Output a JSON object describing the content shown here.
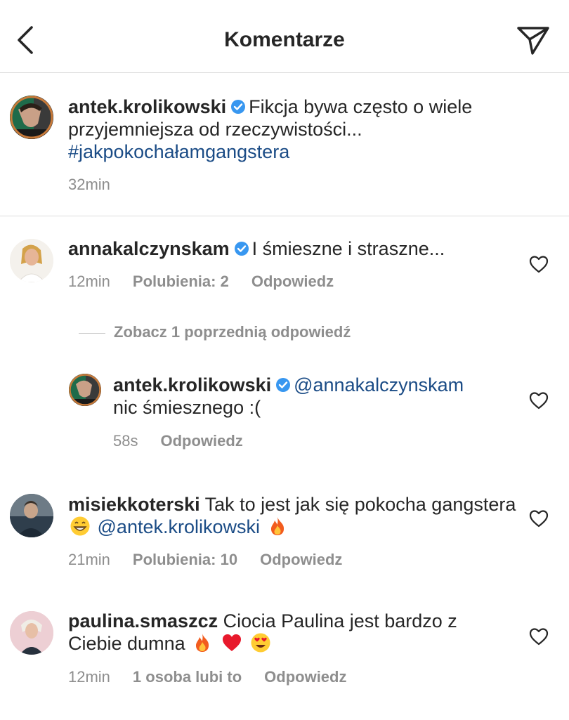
{
  "header": {
    "title": "Komentarze",
    "back_icon": "chevron-left-icon",
    "send_icon": "paper-plane-icon"
  },
  "caption": {
    "username": "antek.krolikowski",
    "text": "Fikcja bywa często o wiele przyjemniejsza od rzeczywistości...",
    "hashtag": "#jakpokochałamgangstera",
    "time": "32min"
  },
  "comments": [
    {
      "username": "annakalczynskam",
      "text": "I śmieszne i straszne...",
      "time": "12min",
      "likes": "Polubienia: 2",
      "reply": "Odpowiedz",
      "view_replies": "Zobacz 1 poprzednią odpowiedź",
      "replies": [
        {
          "username": "antek.krolikowski",
          "mention": "@annakalczynskam",
          "text": "nic śmiesznego :(",
          "time": "58s",
          "reply": "Odpowiedz"
        }
      ]
    },
    {
      "username": "misiekkoterski",
      "text_before": "Tak to jest jak się pokocha gangstera",
      "mention": "@antek.krolikowski",
      "time": "21min",
      "likes": "Polubienia: 10",
      "reply": "Odpowiedz"
    },
    {
      "username": "paulina.smaszcz",
      "text": "Ciocia Paulina jest bardzo z Ciebie dumna",
      "time": "12min",
      "likes": "1 osoba lubi to",
      "reply": "Odpowiedz"
    }
  ],
  "colors": {
    "link": "#1b4c86",
    "verified": "#3897f0",
    "meta": "#8e8e8e"
  }
}
